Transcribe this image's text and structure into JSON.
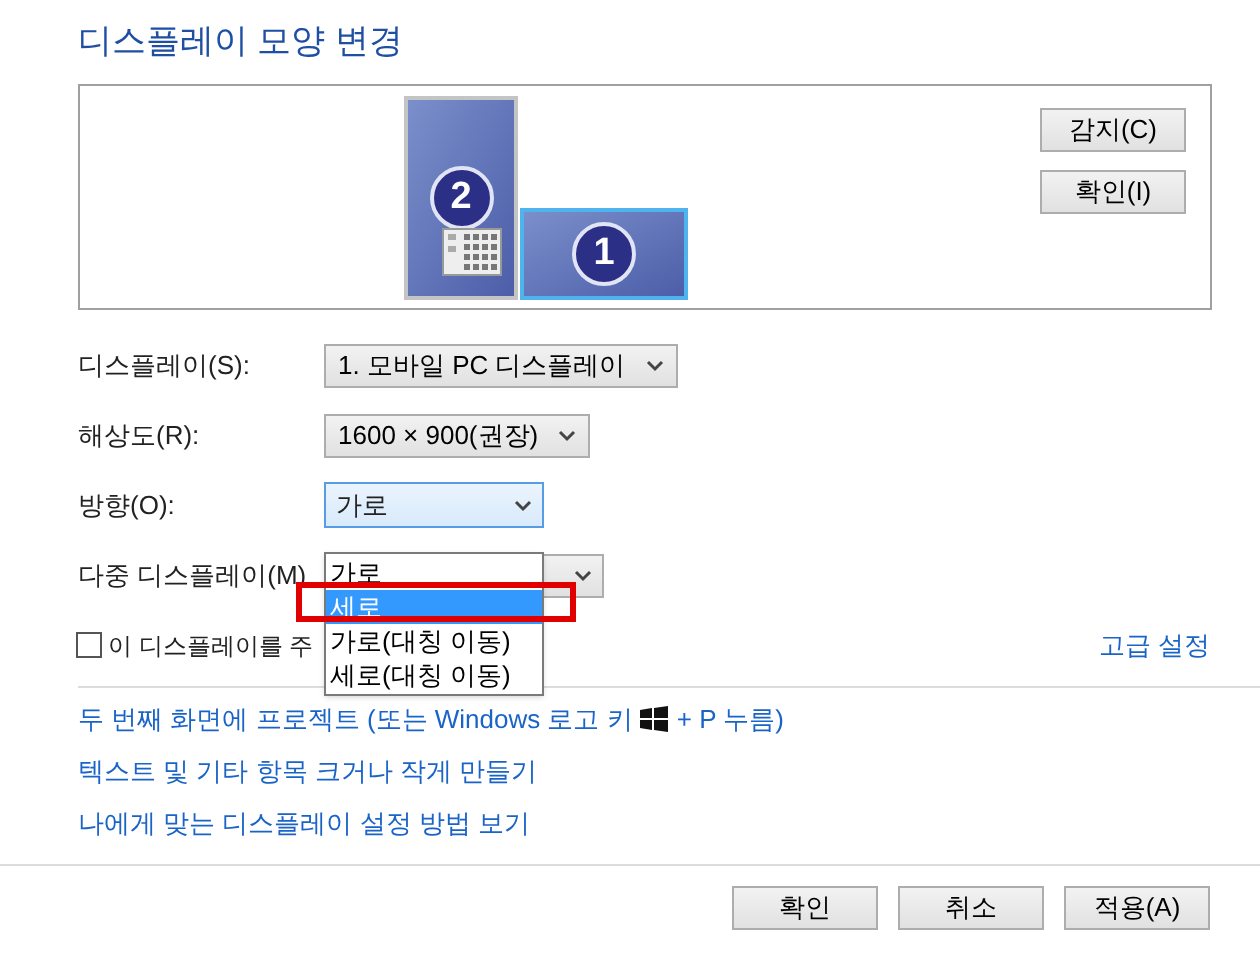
{
  "title": "디스플레이 모양 변경",
  "preview": {
    "monitors": [
      {
        "number": "2",
        "selected": false
      },
      {
        "number": "1",
        "selected": true
      }
    ],
    "buttons": [
      "감지(C)",
      "확인(I)"
    ]
  },
  "fields": [
    {
      "label": "디스플레이(S):",
      "value": "1. 모바일 PC 디스플레이",
      "kind": "select"
    },
    {
      "label": "해상도(R):",
      "value": "1600 × 900(권장)",
      "kind": "select"
    },
    {
      "label": "방향(O):",
      "value": "가로",
      "kind": "open"
    },
    {
      "label": "다중 디스플레이(M)",
      "kind": "covered"
    }
  ],
  "orientation_options": [
    {
      "label": "가로",
      "selected": false
    },
    {
      "label": "세로",
      "selected": true
    },
    {
      "label": "가로(대칭 이동)",
      "selected": false
    },
    {
      "label": "세로(대칭 이동)",
      "selected": false
    }
  ],
  "main_display_checkbox": {
    "label": "이 디스플레이를 주",
    "checked": false
  },
  "advanced_link": "고급 설정",
  "links": [
    {
      "before": "두 번째 화면에 프로젝트 (또는 Windows 로고 키",
      "after": "+ P 누름)"
    },
    {
      "before": "텍스트 및 기타 항목 크거나 작게 만들기"
    },
    {
      "before": "나에게 맞는 디스플레이 설정 방법 보기"
    }
  ],
  "footer_buttons": [
    "확인",
    "취소",
    "적용(A)"
  ]
}
